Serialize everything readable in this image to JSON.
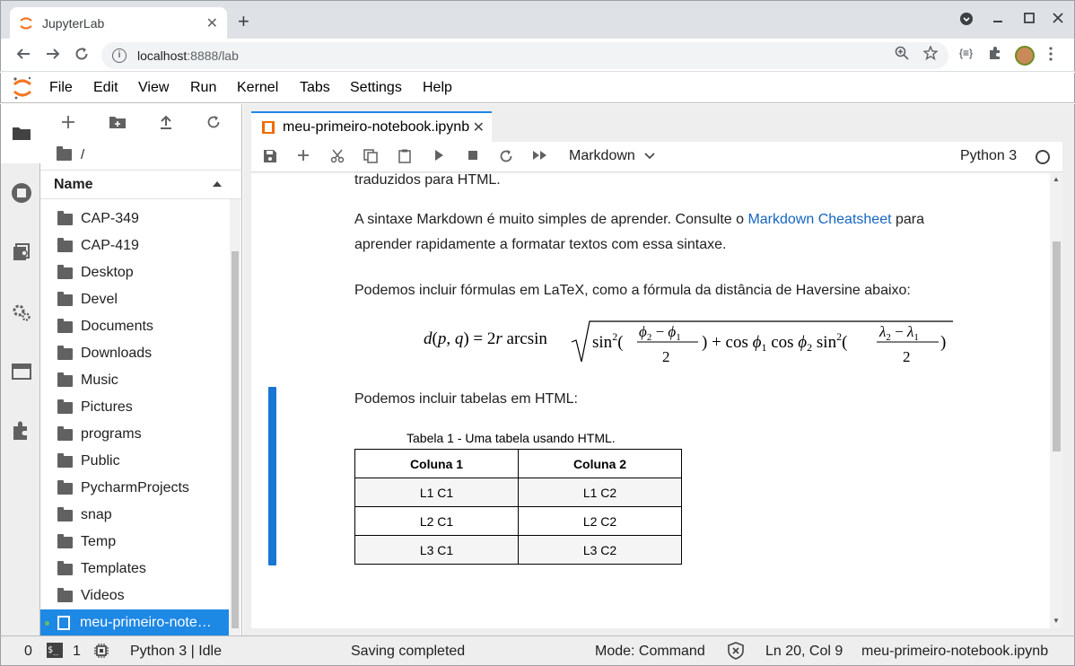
{
  "browser": {
    "tab_title": "JupyterLab",
    "tab_close": "✕",
    "new_tab": "+",
    "url_host": "localhost",
    "url_path": ":8888/lab"
  },
  "menubar": [
    "File",
    "Edit",
    "View",
    "Run",
    "Kernel",
    "Tabs",
    "Settings",
    "Help"
  ],
  "filebrowser": {
    "path": "/",
    "header": "Name",
    "items": [
      {
        "name": "CAP-349"
      },
      {
        "name": "CAP-419"
      },
      {
        "name": "Desktop"
      },
      {
        "name": "Devel"
      },
      {
        "name": "Documents"
      },
      {
        "name": "Downloads"
      },
      {
        "name": "Music"
      },
      {
        "name": "Pictures"
      },
      {
        "name": "programs"
      },
      {
        "name": "Public"
      },
      {
        "name": "PycharmProjects"
      },
      {
        "name": "snap"
      },
      {
        "name": "Temp"
      },
      {
        "name": "Templates"
      },
      {
        "name": "Videos"
      }
    ],
    "selected_item": "meu-primeiro-note…"
  },
  "notebook": {
    "tab_name": "meu-primeiro-notebook.ipynb",
    "tab_close": "✕",
    "cell_type": "Markdown",
    "kernel": "Python 3",
    "content": {
      "p0": "traduzidos para HTML.",
      "p1_a": "A sintaxe Markdown é muito simples de aprender. Consulte o ",
      "p1_link": "Markdown Cheatsheet",
      "p1_b": " para",
      "p1_c": "aprender rapidamente a formatar textos com essa sintaxe.",
      "p2": "Podemos incluir fórmulas em LaTeX, como a fórmula da distância de Haversine abaixo:",
      "p3": "Podemos incluir tabelas em HTML:",
      "table_caption": "Tabela 1 - Uma tabela usando HTML.",
      "table_headers": [
        "Coluna 1",
        "Coluna 2"
      ],
      "table_rows": [
        [
          "L1 C1",
          "L1 C2"
        ],
        [
          "L2 C1",
          "L2 C2"
        ],
        [
          "L3 C1",
          "L3 C2"
        ]
      ]
    }
  },
  "statusbar": {
    "terminals": "0",
    "kernels": "1",
    "kernel_status": "Python 3 | Idle",
    "save_status": "Saving completed",
    "mode": "Mode: Command",
    "position": "Ln 20, Col 9",
    "filename": "meu-primeiro-notebook.ipynb"
  },
  "colors": {
    "accent": "#1e88e5",
    "jupyter_orange": "#f37726"
  }
}
